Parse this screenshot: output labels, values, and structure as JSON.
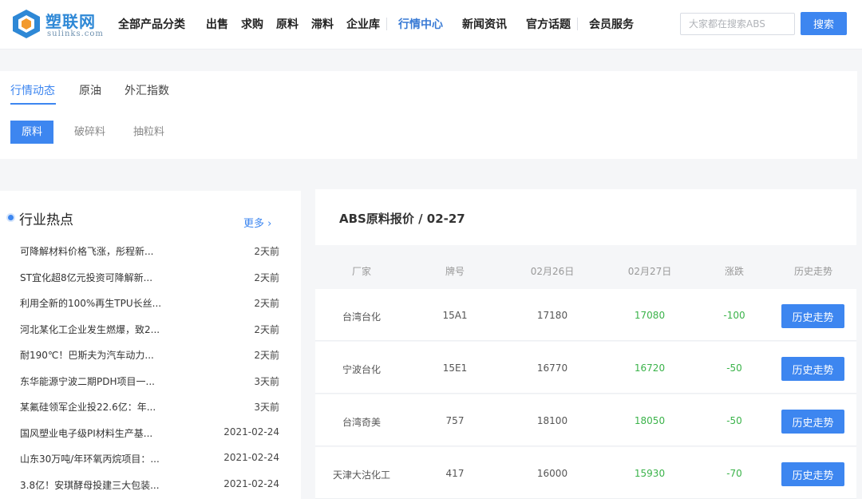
{
  "header": {
    "logo_cn": "塑联网",
    "logo_en": "sulinks.com",
    "nav": [
      "全部产品分类",
      "出售",
      "求购",
      "原料",
      "滞料",
      "企业库",
      "行情中心",
      "新闻资讯",
      "官方话题",
      "会员服务"
    ],
    "active_nav": "行情中心",
    "search_placeholder": "大家都在搜索ABS",
    "search_button": "搜索"
  },
  "tabs": [
    "行情动态",
    "原油",
    "外汇指数"
  ],
  "sub_tabs": [
    "原料",
    "破碎料",
    "抽粒料"
  ],
  "hot": {
    "title": "行业热点",
    "more": "更多 ›",
    "items": [
      {
        "title": "可降解材料价格飞涨，彤程新...",
        "time": "2天前"
      },
      {
        "title": "ST宜化超8亿元投资可降解新...",
        "time": "2天前"
      },
      {
        "title": "利用全新的100%再生TPU长丝...",
        "time": "2天前"
      },
      {
        "title": "河北某化工企业发生燃爆，致2...",
        "time": "2天前"
      },
      {
        "title": "耐190℃！巴斯夫为汽车动力...",
        "time": "2天前"
      },
      {
        "title": "东华能源宁波二期PDH项目一...",
        "time": "3天前"
      },
      {
        "title": "某氟硅领军企业投22.6亿：年...",
        "time": "3天前"
      },
      {
        "title": "国风塑业电子级PI材料生产基...",
        "time": "2021-02-24"
      },
      {
        "title": "山东30万吨/年环氧丙烷项目：...",
        "time": "2021-02-24"
      },
      {
        "title": "3.8亿！安琪酵母投建三大包装...",
        "time": "2021-02-24"
      }
    ]
  },
  "price": {
    "title": "ABS原料报价 / 02-27",
    "columns": [
      "厂家",
      "牌号",
      "02月26日",
      "02月27日",
      "涨跌",
      "历史走势"
    ],
    "rows": [
      {
        "maker": "台湾台化",
        "grade": "15A1",
        "prev": "17180",
        "cur": "17080",
        "change": "-100",
        "btn": "历史走势"
      },
      {
        "maker": "宁波台化",
        "grade": "15E1",
        "prev": "16770",
        "cur": "16720",
        "change": "-50",
        "btn": "历史走势"
      },
      {
        "maker": "台湾奇美",
        "grade": "757",
        "prev": "18100",
        "cur": "18050",
        "change": "-50",
        "btn": "历史走势"
      },
      {
        "maker": "天津大沽化工",
        "grade": "417",
        "prev": "16000",
        "cur": "15930",
        "change": "-70",
        "btn": "历史走势"
      }
    ]
  },
  "colors": {
    "accent": "#3d86f0",
    "down": "#3bb34a"
  }
}
